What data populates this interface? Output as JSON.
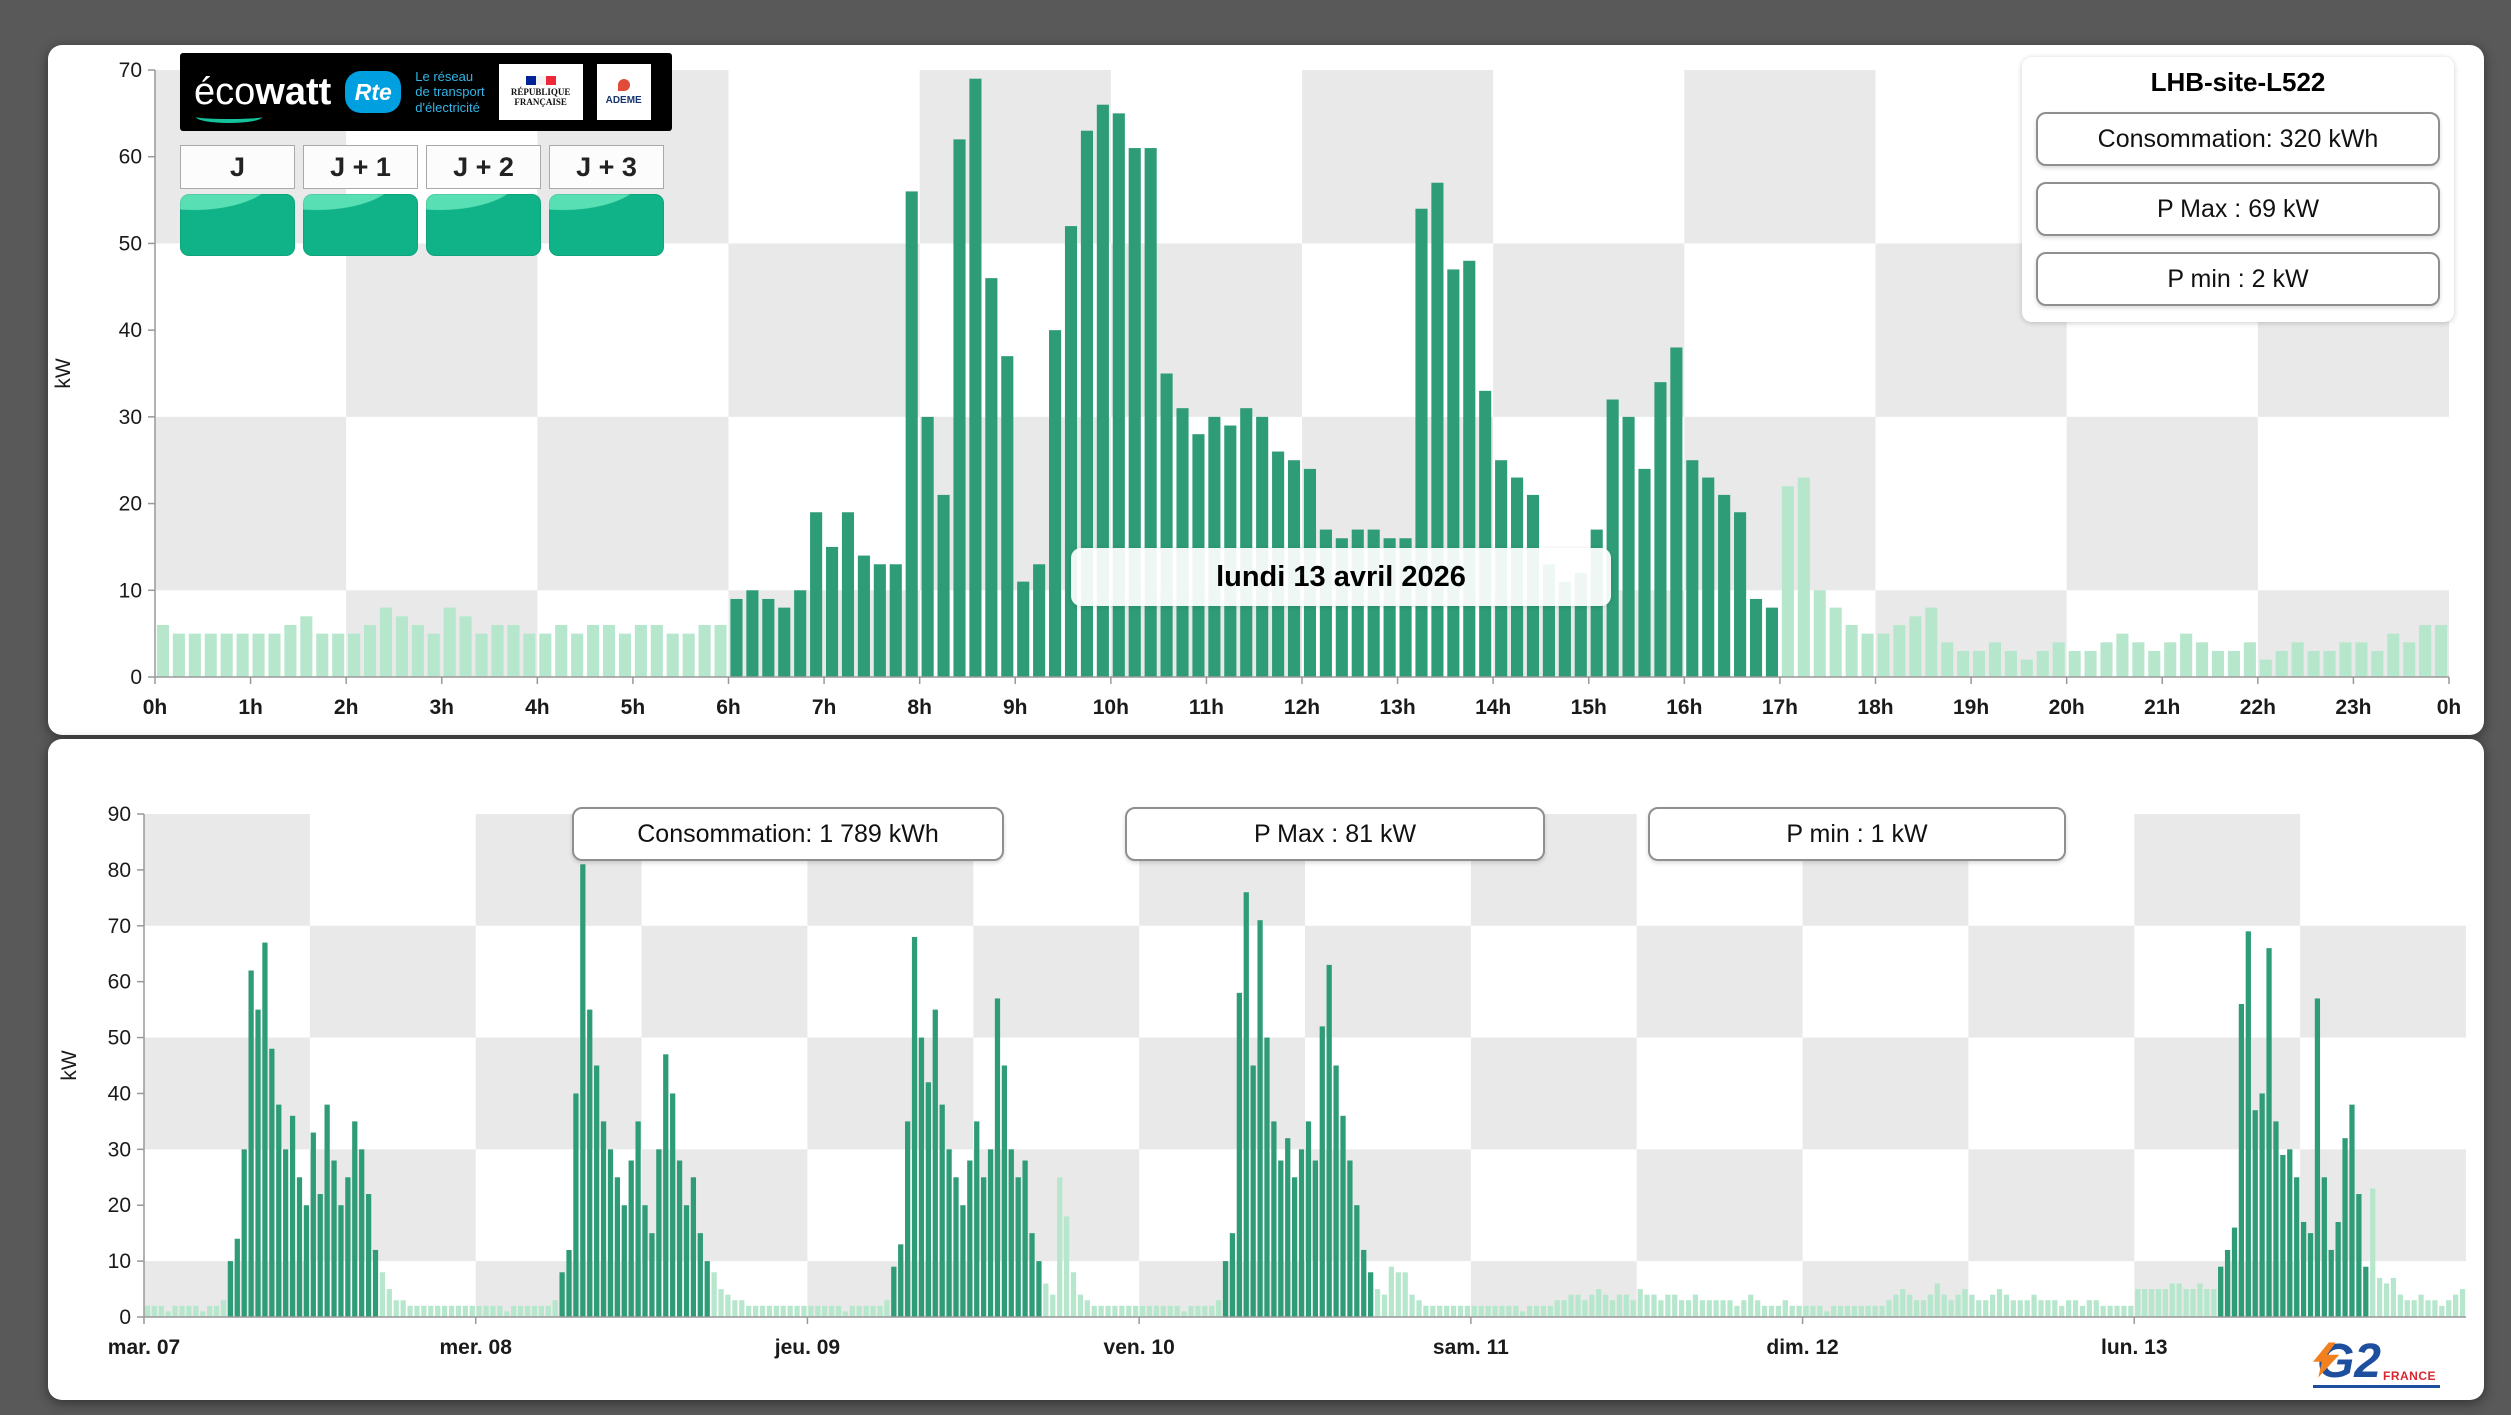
{
  "colors": {
    "background": "#595959",
    "panel": "#ffffff",
    "active_bar": "#2e9c76",
    "standby_bar": "#b6e7cd",
    "band": "#e9e9e9",
    "ecowatt_teal": "#14c39c",
    "rte_blue": "#009fdf",
    "g2e_blue": "#1d4f9e",
    "g2e_orange": "#f2801e",
    "g2e_red": "#d7282f"
  },
  "top_panel": {
    "ecowatt": {
      "brand_eco": "éco",
      "brand_watt": "watt",
      "rte": "Rte",
      "rte_caption": "Le réseau\nde transport\nd'électricité",
      "republique": "RÉPUBLIQUE\nFRANÇAISE",
      "ademe": "ADEME",
      "days": [
        "J",
        "J + 1",
        "J + 2",
        "J + 3"
      ]
    }
  },
  "bottom_panel": {
    "logo": {
      "brand": "G2",
      "country": "FRANCE"
    }
  },
  "chart_data": [
    {
      "type": "bar",
      "title": "lundi 13 avril 2026",
      "site": "LHB-site-L522",
      "annotations": [
        "Consommation: 320 kWh",
        "P Max :  69 kW",
        "P min : 2 kW"
      ],
      "ylabel": "kW",
      "ylim": [
        0,
        70
      ],
      "ytick": 10,
      "slots_per_hour": 6,
      "legend_position": "none",
      "xticks": [
        {
          "pos": 0,
          "label": "0h"
        },
        {
          "pos": 6,
          "label": "1h"
        },
        {
          "pos": 12,
          "label": "2h"
        },
        {
          "pos": 18,
          "label": "3h"
        },
        {
          "pos": 24,
          "label": "4h"
        },
        {
          "pos": 30,
          "label": "5h"
        },
        {
          "pos": 36,
          "label": "6h"
        },
        {
          "pos": 42,
          "label": "7h"
        },
        {
          "pos": 48,
          "label": "8h"
        },
        {
          "pos": 54,
          "label": "9h"
        },
        {
          "pos": 60,
          "label": "10h"
        },
        {
          "pos": 66,
          "label": "11h"
        },
        {
          "pos": 72,
          "label": "12h"
        },
        {
          "pos": 78,
          "label": "13h"
        },
        {
          "pos": 84,
          "label": "14h"
        },
        {
          "pos": 90,
          "label": "15h"
        },
        {
          "pos": 96,
          "label": "16h"
        },
        {
          "pos": 102,
          "label": "17h"
        },
        {
          "pos": 108,
          "label": "18h"
        },
        {
          "pos": 114,
          "label": "19h"
        },
        {
          "pos": 120,
          "label": "20h"
        },
        {
          "pos": 126,
          "label": "21h"
        },
        {
          "pos": 132,
          "label": "22h"
        },
        {
          "pos": 138,
          "label": "23h"
        },
        {
          "pos": 144,
          "label": "0h"
        }
      ],
      "active_ranges": [
        [
          36,
          102
        ]
      ],
      "values": [
        6,
        5,
        5,
        5,
        5,
        5,
        5,
        5,
        6,
        7,
        5,
        5,
        5,
        6,
        8,
        7,
        6,
        5,
        8,
        7,
        5,
        6,
        6,
        5,
        5,
        6,
        5,
        6,
        6,
        5,
        6,
        6,
        5,
        5,
        6,
        6,
        9,
        10,
        9,
        8,
        10,
        19,
        15,
        19,
        14,
        13,
        13,
        56,
        30,
        21,
        62,
        69,
        46,
        37,
        11,
        13,
        40,
        52,
        63,
        66,
        65,
        61,
        61,
        35,
        31,
        28,
        30,
        29,
        31,
        30,
        26,
        25,
        24,
        17,
        16,
        17,
        17,
        16,
        16,
        54,
        57,
        47,
        48,
        33,
        25,
        23,
        21,
        13,
        11,
        12,
        17,
        32,
        30,
        24,
        34,
        38,
        25,
        23,
        21,
        19,
        9,
        8,
        22,
        23,
        10,
        8,
        6,
        5,
        5,
        6,
        7,
        8,
        4,
        3,
        3,
        4,
        3,
        2,
        3,
        4,
        3,
        3,
        4,
        5,
        4,
        3,
        4,
        5,
        4,
        3,
        3,
        4,
        2,
        3,
        4,
        3,
        3,
        4,
        4,
        3,
        5,
        4,
        6,
        6
      ]
    },
    {
      "type": "bar",
      "title": "",
      "annotations": [
        "Consommation: 1 789 kWh",
        "P Max :  81 kW",
        "P min : 1 kW"
      ],
      "ylabel": "kW",
      "ylim": [
        0,
        90
      ],
      "ytick": 10,
      "slots_per_day": 48,
      "legend_position": "none",
      "xticks": [
        {
          "pos": 0,
          "label": "mar. 07"
        },
        {
          "pos": 48,
          "label": "mer. 08"
        },
        {
          "pos": 96,
          "label": "jeu. 09"
        },
        {
          "pos": 144,
          "label": "ven. 10"
        },
        {
          "pos": 192,
          "label": "sam. 11"
        },
        {
          "pos": 240,
          "label": "dim. 12"
        },
        {
          "pos": 288,
          "label": "lun. 13"
        }
      ],
      "active_ranges": [
        [
          12,
          34
        ],
        [
          60,
          82
        ],
        [
          108,
          130
        ],
        [
          156,
          178
        ],
        [
          300,
          322
        ]
      ],
      "values": [
        2,
        2,
        2,
        1,
        2,
        2,
        2,
        2,
        1,
        2,
        2,
        3,
        10,
        14,
        30,
        62,
        55,
        67,
        48,
        38,
        30,
        36,
        25,
        20,
        33,
        22,
        38,
        28,
        20,
        25,
        35,
        30,
        22,
        12,
        8,
        5,
        3,
        3,
        2,
        2,
        2,
        2,
        2,
        2,
        2,
        2,
        2,
        2,
        2,
        2,
        2,
        2,
        1,
        2,
        2,
        2,
        2,
        2,
        2,
        3,
        8,
        12,
        40,
        81,
        55,
        45,
        35,
        30,
        25,
        20,
        28,
        35,
        20,
        15,
        30,
        47,
        40,
        28,
        20,
        25,
        15,
        10,
        8,
        5,
        4,
        3,
        3,
        2,
        2,
        2,
        2,
        2,
        2,
        2,
        2,
        2,
        2,
        2,
        2,
        2,
        2,
        1,
        2,
        2,
        2,
        2,
        2,
        3,
        9,
        13,
        35,
        68,
        50,
        42,
        55,
        38,
        30,
        25,
        20,
        28,
        35,
        25,
        30,
        57,
        45,
        30,
        25,
        28,
        15,
        10,
        6,
        4,
        25,
        18,
        8,
        4,
        3,
        2,
        2,
        2,
        2,
        2,
        2,
        2,
        2,
        2,
        2,
        2,
        2,
        2,
        1,
        2,
        2,
        2,
        2,
        3,
        10,
        15,
        58,
        76,
        45,
        71,
        50,
        35,
        28,
        32,
        25,
        30,
        35,
        28,
        52,
        63,
        45,
        36,
        28,
        20,
        12,
        8,
        5,
        4,
        9,
        8,
        8,
        4,
        3,
        2,
        2,
        2,
        2,
        2,
        2,
        2,
        2,
        2,
        2,
        2,
        2,
        2,
        2,
        1,
        2,
        2,
        2,
        2,
        3,
        3,
        4,
        4,
        3,
        4,
        5,
        4,
        3,
        4,
        4,
        3,
        5,
        4,
        4,
        3,
        4,
        4,
        3,
        3,
        4,
        3,
        3,
        3,
        3,
        3,
        2,
        3,
        4,
        3,
        2,
        2,
        2,
        3,
        2,
        2,
        2,
        2,
        2,
        1,
        2,
        2,
        2,
        2,
        2,
        2,
        2,
        2,
        3,
        4,
        5,
        4,
        3,
        3,
        4,
        6,
        4,
        3,
        4,
        5,
        4,
        3,
        3,
        4,
        5,
        4,
        3,
        3,
        3,
        4,
        3,
        3,
        3,
        2,
        3,
        3,
        2,
        3,
        3,
        2,
        2,
        2,
        2,
        2,
        5,
        5,
        5,
        5,
        5,
        6,
        6,
        5,
        5,
        6,
        5,
        5,
        9,
        12,
        16,
        56,
        69,
        37,
        40,
        66,
        35,
        29,
        30,
        25,
        17,
        15,
        57,
        25,
        12,
        17,
        32,
        38,
        22,
        9,
        23,
        7,
        6,
        7,
        4,
        3,
        3,
        4,
        3,
        3,
        2,
        3,
        4,
        5
      ]
    }
  ]
}
